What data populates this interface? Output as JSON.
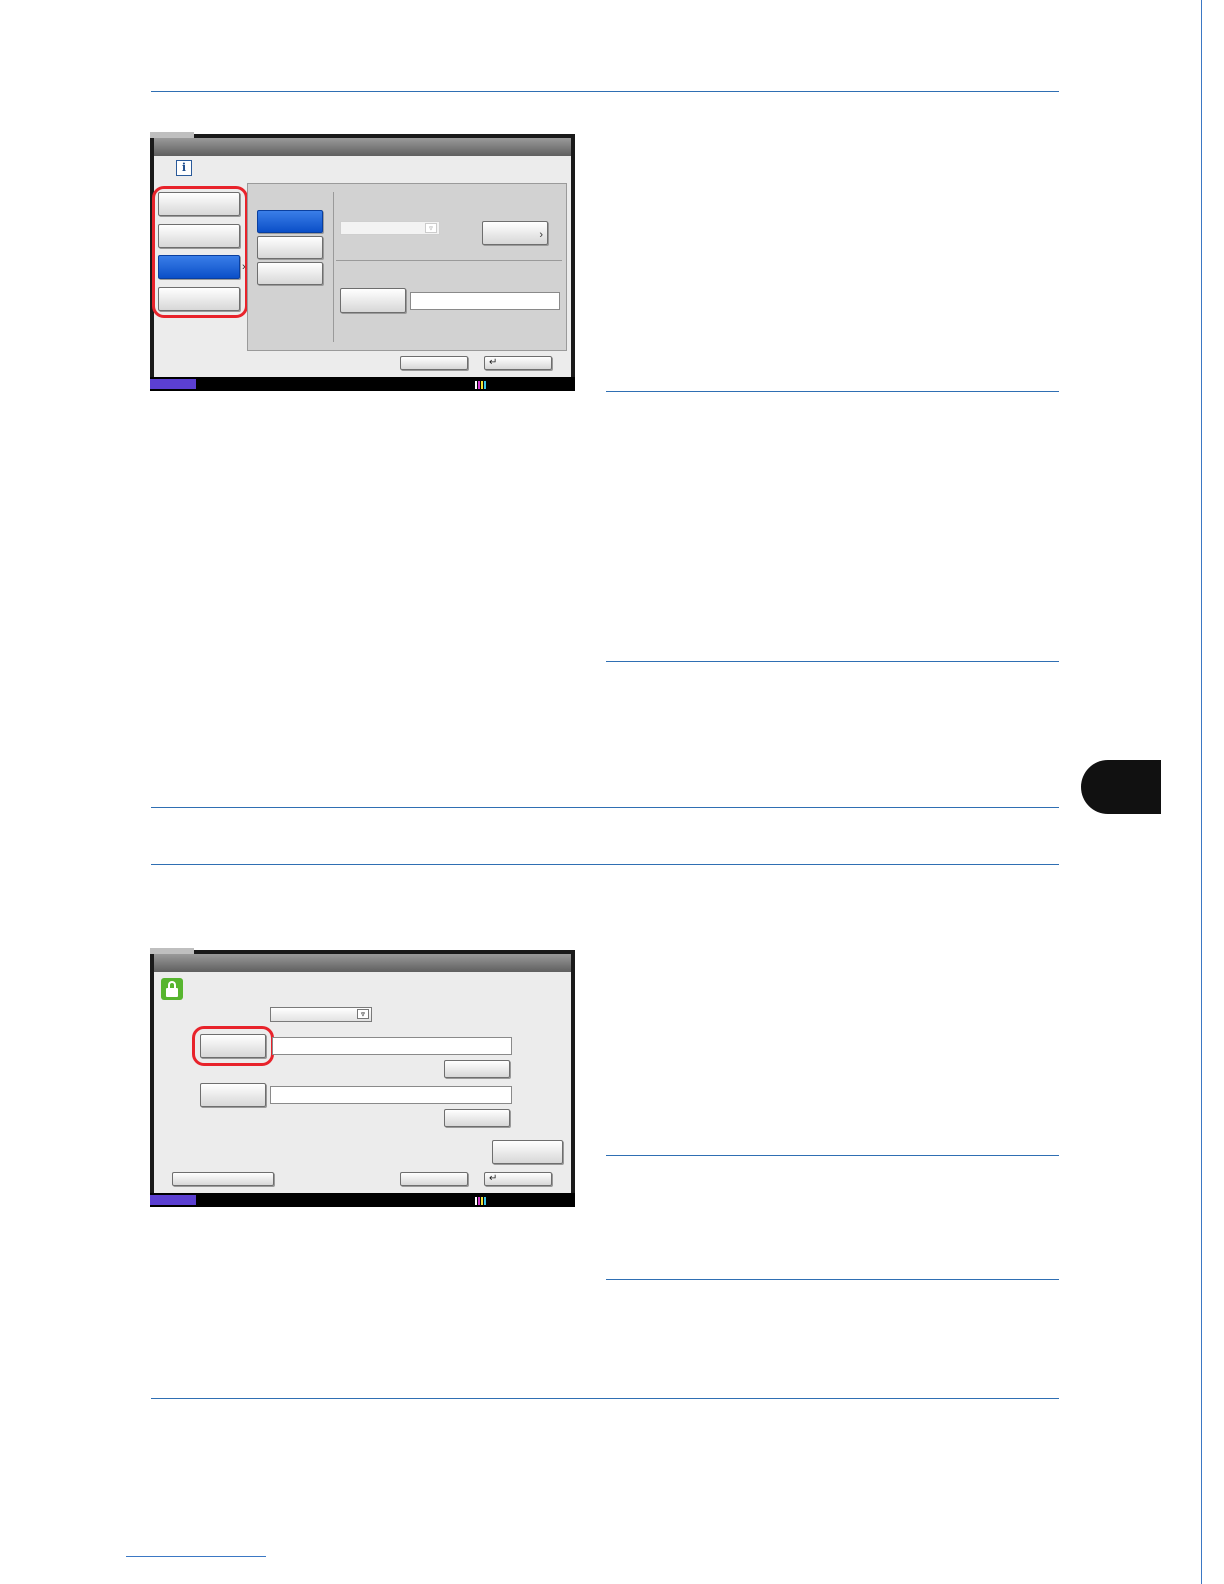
{
  "page": {
    "chapter_tab": ""
  },
  "screen_top": {
    "info_icon": "info-icon",
    "left_menu": [
      "",
      "",
      "",
      ""
    ],
    "left_menu_selected_index": 2,
    "sub_menu": [
      "",
      "",
      ""
    ],
    "sub_menu_selected_index": 0,
    "footer_buttons": [
      "",
      ""
    ],
    "enter_symbol": "↵",
    "chevron_symbol": "›",
    "dropdown_symbol": "⩔",
    "colors": {
      "selected": "#0b4fc8",
      "highlight": "#e8232b",
      "status_tag": "#5b3fd1"
    }
  },
  "screen_bottom": {
    "lock_icon": "unlocked-padlock-icon",
    "footer_buttons": [
      "",
      "",
      ""
    ],
    "enter_symbol": "↵",
    "dropdown_symbol": "⩔",
    "colors": {
      "lock": "#57b52f",
      "highlight": "#e8232b"
    }
  }
}
